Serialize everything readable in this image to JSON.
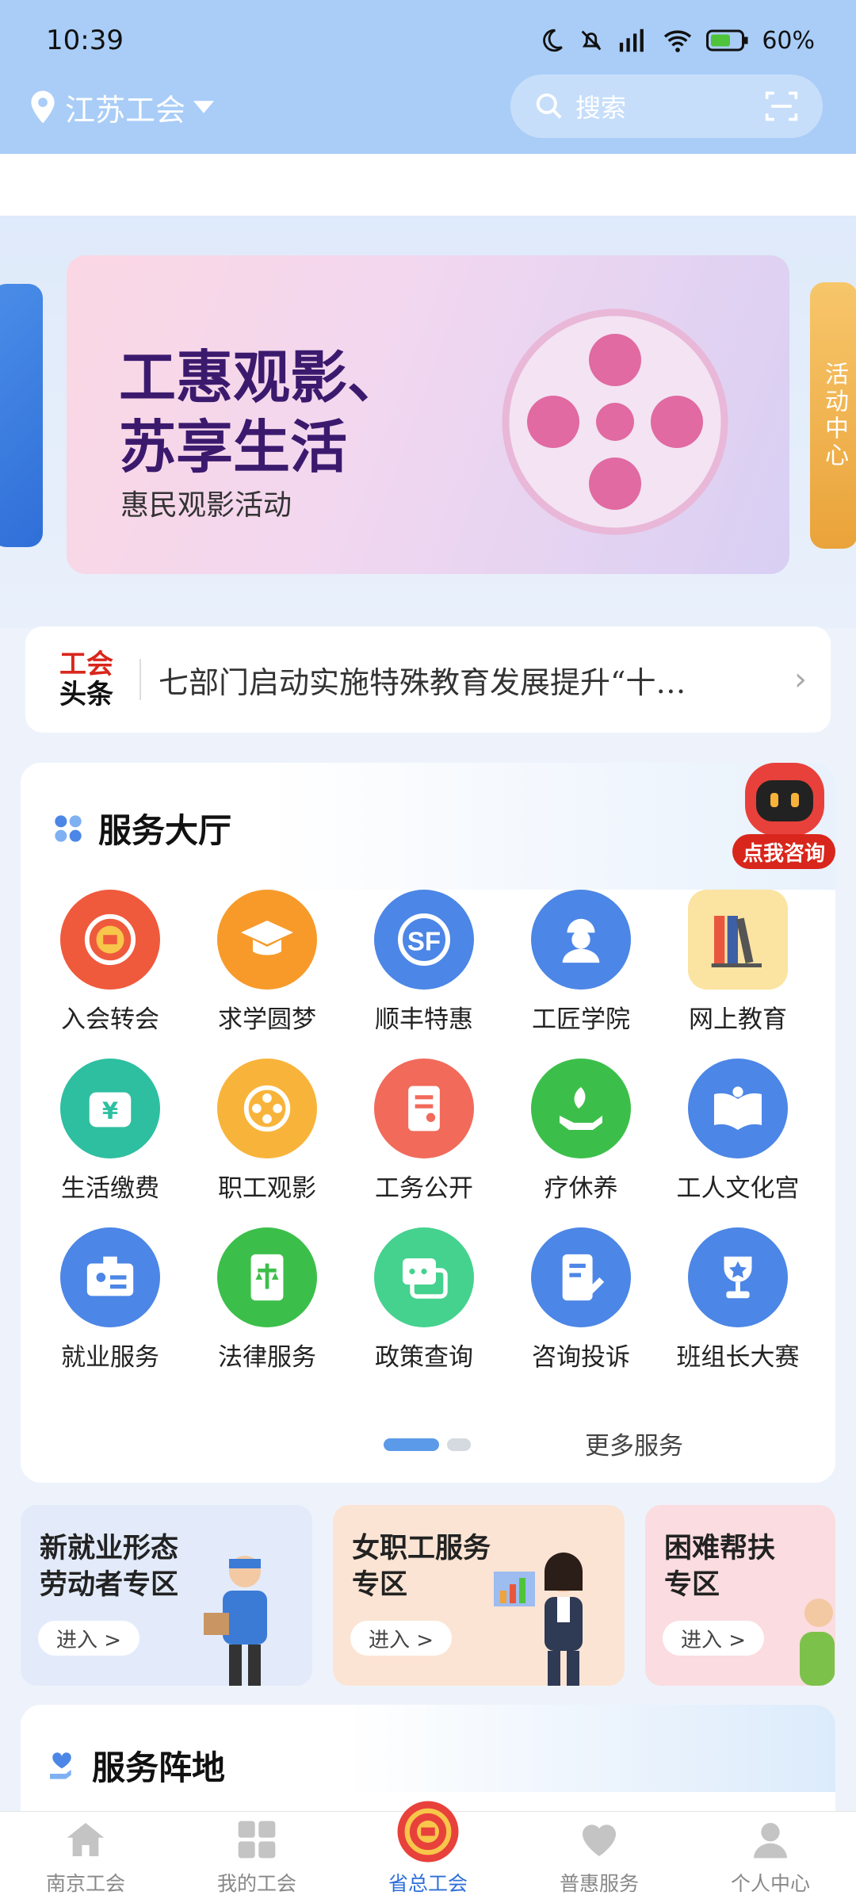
{
  "status_bar": {
    "time": "10:39",
    "battery": "60%"
  },
  "header": {
    "location": "江苏工会",
    "search_placeholder": "搜索"
  },
  "banner": {
    "title_line1": "工惠观影、",
    "title_line2": "苏享生活",
    "subtitle": "惠民观影活动",
    "side_right_label": "活动中心"
  },
  "news": {
    "logo_top": "工会",
    "logo_bottom": "头条",
    "headline": "七部门启动实施特殊教育发展提升“十…"
  },
  "service_hall": {
    "title": "服务大厅",
    "items": [
      {
        "label": "入会转会",
        "icon": "union-badge-icon",
        "color": "#ef5a3c"
      },
      {
        "label": "求学圆梦",
        "icon": "graduation-cap-icon",
        "color": "#f79a2a"
      },
      {
        "label": "顺丰特惠",
        "icon": "sf-logo-icon",
        "color": "#4c86e6"
      },
      {
        "label": "工匠学院",
        "icon": "worker-icon",
        "color": "#4c86e6"
      },
      {
        "label": "网上教育",
        "icon": "books-icon",
        "color": "#fbe3a2"
      },
      {
        "label": "生活缴费",
        "icon": "payment-icon",
        "color": "#2dbfa0"
      },
      {
        "label": "职工观影",
        "icon": "film-reel-icon",
        "color": "#f8b43a"
      },
      {
        "label": "工务公开",
        "icon": "document-icon",
        "color": "#f16a5a"
      },
      {
        "label": "疗休养",
        "icon": "leaf-hand-icon",
        "color": "#3cbf4a"
      },
      {
        "label": "工人文化宫",
        "icon": "open-book-icon",
        "color": "#4c86e6"
      },
      {
        "label": "就业服务",
        "icon": "id-card-icon",
        "color": "#4c86e6"
      },
      {
        "label": "法律服务",
        "icon": "law-book-icon",
        "color": "#3cbf4a"
      },
      {
        "label": "政策查询",
        "icon": "chat-icon",
        "color": "#45d28f"
      },
      {
        "label": "咨询投诉",
        "icon": "edit-doc-icon",
        "color": "#4c86e6"
      },
      {
        "label": "班组长大赛",
        "icon": "trophy-icon",
        "color": "#4c86e6"
      }
    ],
    "more_label": "更多服务"
  },
  "robot": {
    "label": "点我咨询"
  },
  "zones": [
    {
      "title_line1": "新就业形态",
      "title_line2": "劳动者专区",
      "button": "进入 >",
      "bg": "#e3ebfb"
    },
    {
      "title_line1": "女职工服务",
      "title_line2": "专区",
      "button": "进入 >",
      "bg": "#fbe4d4"
    },
    {
      "title_line1": "困难帮扶",
      "title_line2": "专区",
      "button": "进入 >",
      "bg": "#fbdce0"
    }
  ],
  "service_position": {
    "title": "服务阵地"
  },
  "bottom_nav": [
    {
      "label": "南京工会",
      "icon": "home-icon",
      "active": false
    },
    {
      "label": "我的工会",
      "icon": "grid-icon",
      "active": false
    },
    {
      "label": "省总工会",
      "icon": "union-emblem-icon",
      "active": true
    },
    {
      "label": "普惠服务",
      "icon": "heart-icon",
      "active": false
    },
    {
      "label": "个人中心",
      "icon": "person-icon",
      "active": false
    }
  ]
}
